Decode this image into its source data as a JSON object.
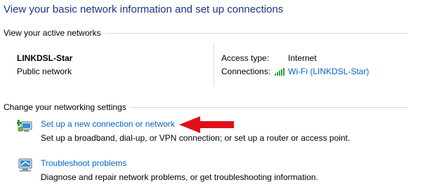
{
  "page": {
    "title": "View your basic network information and set up connections"
  },
  "active_networks": {
    "header": "View your active networks",
    "network_name": "LINKDSL-Star",
    "network_category": "Public network",
    "access_type_label": "Access type:",
    "access_type_value": "Internet",
    "connections_label": "Connections:",
    "connections_value": "Wi-Fi (LINKDSL-Star)",
    "connection_icon": "wifi-signal-icon"
  },
  "settings": {
    "header": "Change your networking settings",
    "tasks": [
      {
        "icon": "new-connection-icon",
        "link": "Set up a new connection or network",
        "description": "Set up a broadband, dial-up, or VPN connection; or set up a router or access point."
      },
      {
        "icon": "troubleshoot-icon",
        "link": "Troubleshoot problems",
        "description": "Diagnose and repair network problems, or get troubleshooting information."
      }
    ]
  },
  "annotation": {
    "icon": "red-arrow-icon",
    "color": "#e0101a"
  },
  "colors": {
    "title": "#1e3287",
    "link": "#0066cc",
    "divider": "#d9d9d9",
    "wifi": "#2fa52f"
  }
}
